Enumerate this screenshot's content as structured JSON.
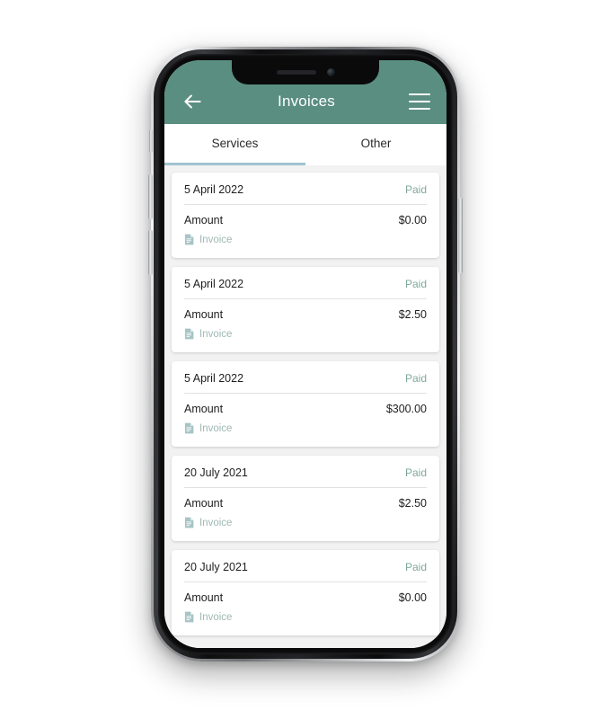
{
  "app": {
    "header": {
      "title": "Invoices",
      "back_icon": "arrow-left-icon",
      "menu_icon": "hamburger-menu-icon",
      "background_color": "#5A8E80"
    },
    "tabs": [
      {
        "label": "Services",
        "active": true
      },
      {
        "label": "Other",
        "active": false
      }
    ],
    "tab_indicator_color": "#9FC4CF",
    "labels": {
      "amount": "Amount",
      "invoice_link": "Invoice",
      "invoice_icon": "document-icon"
    },
    "status_color": "#7FA89C",
    "invoices": [
      {
        "date": "5 April 2022",
        "status": "Paid",
        "amount_label": "Amount",
        "amount": "$0.00",
        "link": "Invoice"
      },
      {
        "date": "5 April 2022",
        "status": "Paid",
        "amount_label": "Amount",
        "amount": "$2.50",
        "link": "Invoice"
      },
      {
        "date": "5 April 2022",
        "status": "Paid",
        "amount_label": "Amount",
        "amount": "$300.00",
        "link": "Invoice"
      },
      {
        "date": "20 July 2021",
        "status": "Paid",
        "amount_label": "Amount",
        "amount": "$2.50",
        "link": "Invoice"
      },
      {
        "date": "20 July 2021",
        "status": "Paid",
        "amount_label": "Amount",
        "amount": "$0.00",
        "link": "Invoice"
      }
    ]
  }
}
